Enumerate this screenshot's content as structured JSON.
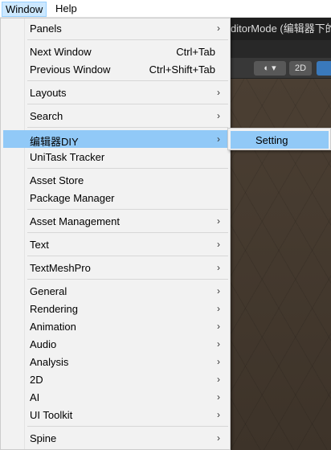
{
  "menubar": {
    "items": [
      "Window",
      "Help"
    ]
  },
  "editor": {
    "title_fragment": "ditorMode (编辑器下的",
    "toolbar_2d": "2D"
  },
  "menu": {
    "panels": "Panels",
    "next_window": "Next Window",
    "next_window_shortcut": "Ctrl+Tab",
    "previous_window": "Previous Window",
    "previous_window_shortcut": "Ctrl+Shift+Tab",
    "layouts": "Layouts",
    "search": "Search",
    "editor_diy": "编辑器DIY",
    "unitask_tracker": "UniTask Tracker",
    "asset_store": "Asset Store",
    "package_manager": "Package Manager",
    "asset_management": "Asset Management",
    "text": "Text",
    "textmeshpro": "TextMeshPro",
    "general": "General",
    "rendering": "Rendering",
    "animation": "Animation",
    "audio": "Audio",
    "analysis": "Analysis",
    "two_d": "2D",
    "ai": "AI",
    "ui_toolkit": "UI Toolkit",
    "spine": "Spine",
    "arrow": "›"
  },
  "submenu": {
    "setting": "Setting"
  }
}
